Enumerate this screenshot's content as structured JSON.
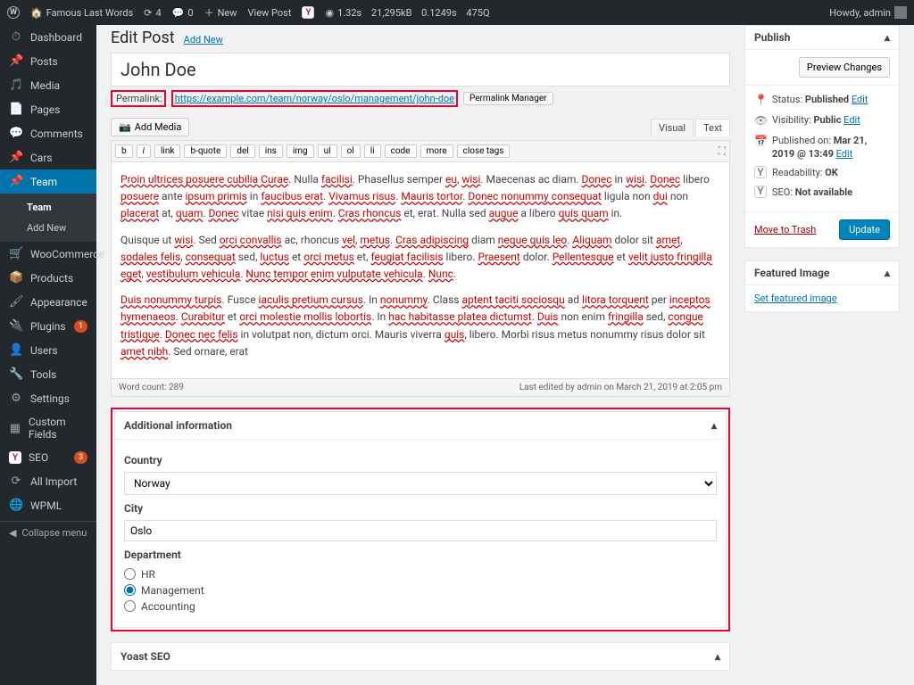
{
  "topbar": {
    "site_name": "Famous Last Words",
    "comments_count": "4",
    "new_count": "0",
    "new_label": "New",
    "view_post": "View Post",
    "perf_time": "1.32s",
    "perf_size": "21,295kB",
    "perf_other": "0.1249s",
    "perf_q": "475Q",
    "howdy": "Howdy, admin"
  },
  "sidebar": {
    "dashboard": "Dashboard",
    "posts": "Posts",
    "media": "Media",
    "pages": "Pages",
    "comments": "Comments",
    "cars": "Cars",
    "team": "Team",
    "team_sub_all": "Team",
    "team_sub_add": "Add New",
    "woocommerce": "WooCommerce",
    "products": "Products",
    "appearance": "Appearance",
    "plugins": "Plugins",
    "plugins_count": "1",
    "users": "Users",
    "tools": "Tools",
    "settings": "Settings",
    "custom_fields": "Custom Fields",
    "seo": "SEO",
    "seo_count": "3",
    "all_import": "All Import",
    "wpml": "WPML",
    "collapse": "Collapse menu"
  },
  "heading": {
    "title": "Edit Post",
    "add_new": "Add New"
  },
  "post": {
    "title": "John Doe",
    "permalink_label": "Permalink:",
    "permalink_url": "https://example.com/team/norway/oslo/management/john-doe",
    "permalink_mgr": "Permalink Manager",
    "add_media": "Add Media",
    "tabs": {
      "visual": "Visual",
      "text": "Text"
    },
    "qt": {
      "b": "b",
      "i": "i",
      "link": "link",
      "bquote": "b-quote",
      "del": "del",
      "ins": "ins",
      "img": "img",
      "ul": "ul",
      "ol": "ol",
      "li": "li",
      "code": "code",
      "more": "more",
      "close": "close tags"
    },
    "wordcount_label": "Word count:",
    "wordcount": "289",
    "lastedit": "Last edited by admin on March 21, 2019 at 2:05 pm"
  },
  "content": {
    "p1a": "Proin ultrices posuere cubilia Curae",
    "p1b": ". Nulla ",
    "p1c": "facilisi",
    "p1d": ". Phasellus semper ",
    "p1e": "eu",
    "p1f": ", ",
    "p1g": "wisi",
    "p1h": ". Maecenas ac diam. ",
    "p1i": "Donec",
    "p1j": " in ",
    "p1k": "wisi",
    "p1l": ". ",
    "p1m": "Donec",
    "p1n": " libero ",
    "p1o": "posuere",
    "p1p": " ante ",
    "p1q": "ipsum primis",
    "p1r": " in ",
    "p1s": "faucibus erat",
    "p1t": ". ",
    "p1u": "Vivamus risus",
    "p1v": ". ",
    "p1w": "Mauris tortor",
    "p1x": ". ",
    "p1y": "Donec nonummy consequat",
    "p1z": " ligula non ",
    "p1aa": "dui",
    "p1ab": " non ",
    "p1ac": "placerat",
    "p1ad": " at, ",
    "p1ae": "quam",
    "p1af": ". ",
    "p1ag": "Donec",
    "p1ah": " vitae ",
    "p1ai": "nisi quis enim",
    "p1aj": ". ",
    "p1ak": "Cras rhoncus",
    "p1al": " et, erat. Nulla sed ",
    "p1am": "augue",
    "p1an": " a libero ",
    "p1ao": "quis quam",
    "p1ap": " in.",
    "p2a": "Quisque ut ",
    "p2b": "wisi",
    "p2c": ". Sed ",
    "p2d": "orci convallis",
    "p2e": " ac, rhoncus ",
    "p2f": "vel",
    "p2g": ", ",
    "p2h": "metus",
    "p2i": ". ",
    "p2j": "Cras adipiscing",
    "p2k": " diam ",
    "p2l": "neque quis leo",
    "p2m": ". ",
    "p2n": "Aliquam",
    "p2o": " dolor sit ",
    "p2p": "amet",
    "p2q": ", ",
    "p2r": "sodales felis",
    "p2s": ", ",
    "p2t": "consequat",
    "p2u": " sed, ",
    "p2v": "luctus",
    "p2w": " et ",
    "p2x": "orci metus",
    "p2y": " et, ",
    "p2z": "feugiat facilisis",
    "p2aa": " libero. ",
    "p2ab": "Praesent",
    "p2ac": " dolor. ",
    "p2ad": "Pellentesque",
    "p2ae": " et ",
    "p2af": "velit justo fringilla eget",
    "p2ag": ", ",
    "p2ah": "vestibulum vehicula",
    "p2ai": ". ",
    "p2aj": "Nunc tempor enim vulputate vehicula",
    "p2ak": ". ",
    "p2al": "Nunc",
    "p2am": ".",
    "p3a": "Duis nonummy turpis",
    "p3b": ". Fusce ",
    "p3c": "iaculis pretium cursus",
    "p3d": ". In ",
    "p3e": "nonummy",
    "p3f": ". Class ",
    "p3g": "aptent taciti sociosqu",
    "p3h": " ad ",
    "p3i": "litora torquent",
    "p3j": " per ",
    "p3k": "inceptos hymenaeos",
    "p3l": ". ",
    "p3m": "Curabitur",
    "p3n": " et ",
    "p3o": "orci molestie mollis lobortis",
    "p3p": ". In ",
    "p3q": "hac habitasse platea dictumst",
    "p3r": ". ",
    "p3s": "Duis",
    "p3t": " non enim ",
    "p3u": "fringilla",
    "p3v": " sed, ",
    "p3w": "congue tristique",
    "p3x": ". ",
    "p3y": "Donec nec felis",
    "p3z": " in volutpat non, dictum orci. Mauris viverra ",
    "p3aa": "quis",
    "p3ab": ", libero. Morbi risus metus nonummy risus dolor sit ",
    "p3ac": "amet nibh",
    "p3ad": ". Sed ornare, erat"
  },
  "metabox": {
    "title": "Additional information",
    "country_label": "Country",
    "country_value": "Norway",
    "city_label": "City",
    "city_value": "Oslo",
    "dept_label": "Department",
    "dept_hr": "HR",
    "dept_mgmt": "Management",
    "dept_acct": "Accounting"
  },
  "nextbox": "Yoast SEO",
  "publish": {
    "title": "Publish",
    "preview": "Preview Changes",
    "status_label": "Status:",
    "status_val": "Published",
    "edit": "Edit",
    "vis_label": "Visibility:",
    "vis_val": "Public",
    "pub_label": "Published on:",
    "pub_val": "Mar 21, 2019 @ 13:49",
    "read_label": "Readability:",
    "read_val": "OK",
    "seo_label": "SEO:",
    "seo_val": "Not available",
    "trash": "Move to Trash",
    "update": "Update"
  },
  "featured": {
    "title": "Featured Image",
    "link": "Set featured image"
  }
}
